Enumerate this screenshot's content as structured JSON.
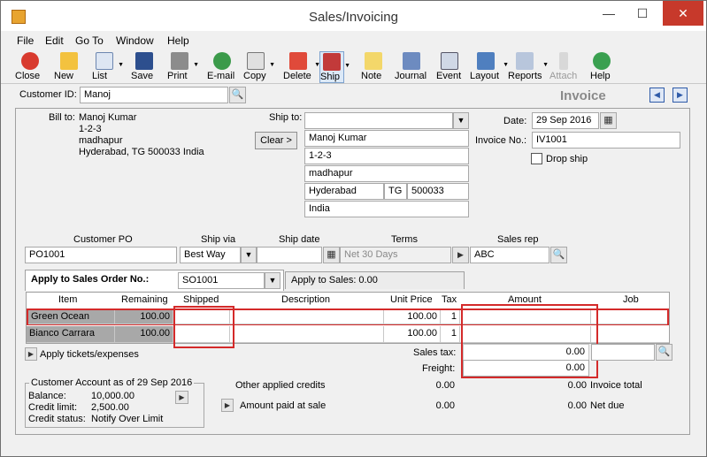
{
  "window": {
    "title": "Sales/Invoicing",
    "minimize": "—",
    "maximize": "☐",
    "close": "✕"
  },
  "menu": [
    "File",
    "Edit",
    "Go To",
    "Window",
    "Help"
  ],
  "toolbar": {
    "close": "Close",
    "new": "New",
    "list": "List",
    "save": "Save",
    "print": "Print",
    "email": "E-mail",
    "copy": "Copy",
    "delete": "Delete",
    "ship": "Ship",
    "note": "Note",
    "journal": "Journal",
    "event": "Event",
    "layout": "Layout",
    "reports": "Reports",
    "attach": "Attach",
    "help": "Help"
  },
  "header": {
    "customer_label": "Customer ID:",
    "customer_value": "Manoj",
    "form_title": "Invoice"
  },
  "billto": {
    "label": "Bill to:",
    "lines": [
      "Manoj Kumar",
      "1-2-3",
      "madhapur",
      "Hyderabad, TG 500033 India"
    ]
  },
  "shipto": {
    "label": "Ship to:",
    "value": "",
    "clear": "Clear",
    "name": "Manoj Kumar",
    "line1": "1-2-3",
    "line2": "madhapur",
    "city": "Hyderabad",
    "state": "TG",
    "zip": "500033",
    "country": "India"
  },
  "invoice": {
    "date_label": "Date:",
    "date": "29 Sep 2016",
    "no_label": "Invoice No.:",
    "no": "IV1001",
    "dropship": "Drop ship"
  },
  "order": {
    "po_label": "Customer PO",
    "po": "PO1001",
    "shipvia_label": "Ship via",
    "shipvia": "Best Way",
    "shipdate_label": "Ship date",
    "shipdate": "",
    "terms_label": "Terms",
    "terms": "Net 30 Days",
    "rep_label": "Sales rep",
    "rep": "ABC"
  },
  "tabs": {
    "so_label": "Apply to Sales Order No.:",
    "so_value": "SO1001",
    "sales_label": "Apply to Sales: 0.00"
  },
  "grid": {
    "columns": [
      "Item",
      "Remaining",
      "Shipped",
      "Description",
      "Unit Price",
      "Tax",
      "Amount",
      "Job"
    ],
    "rows": [
      {
        "item": "Green Ocean",
        "remaining": "100.00",
        "shipped": "",
        "description": "",
        "unit_price": "100.00",
        "tax": "1",
        "amount": "",
        "job": ""
      },
      {
        "item": "Bianco Carrara",
        "remaining": "100.00",
        "shipped": "",
        "description": "",
        "unit_price": "100.00",
        "tax": "1",
        "amount": "",
        "job": ""
      }
    ]
  },
  "apply_tickets": "Apply tickets/expenses",
  "totals": {
    "sales_tax_label": "Sales tax:",
    "sales_tax": "0.00",
    "freight_label": "Freight:",
    "freight": "0.00",
    "credits_label": "Other applied credits",
    "credits": "0.00",
    "invoice_total_value": "0.00",
    "invoice_total_label": "Invoice total",
    "paid_label": "Amount paid at sale",
    "paid": "0.00",
    "net_due_value": "0.00",
    "net_due_label": "Net due"
  },
  "account": {
    "title": "Customer Account as of 29 Sep 2016",
    "balance_label": "Balance:",
    "balance": "10,000.00",
    "limit_label": "Credit limit:",
    "limit": "2,500.00",
    "status_label": "Credit status:",
    "status": "Notify Over Limit"
  }
}
